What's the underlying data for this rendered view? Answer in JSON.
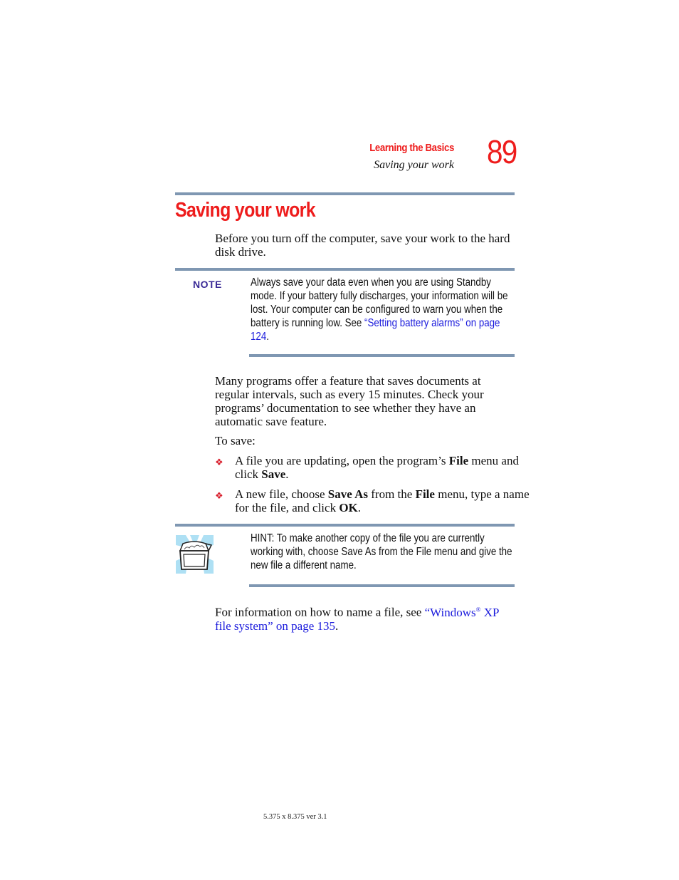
{
  "header": {
    "chapter": "Learning the Basics",
    "section": "Saving your work",
    "page_number": "89"
  },
  "title": "Saving your work",
  "intro": "Before you turn off the computer, save your work to the hard disk drive.",
  "note": {
    "label": "NOTE",
    "text_before_link": "Always save your data even when you are using Standby mode. If your battery fully discharges, your information will be lost. Your computer can be configured to warn you when the battery is running low. See ",
    "link_text": "“Setting battery alarms” on page 124",
    "text_after_link": "."
  },
  "paragraph": "Many programs offer a feature that saves documents at regular intervals, such as every 15 minutes. Check your programs’ documentation to see whether they have an automatic save feature.",
  "to_save": "To save:",
  "bullets": [
    {
      "icon": "diamond-bullet-icon",
      "parts": [
        {
          "text": "A file you are updating, open the program’s ",
          "bold": false
        },
        {
          "text": "File",
          "bold": true
        },
        {
          "text": " menu and click ",
          "bold": false
        },
        {
          "text": "Save",
          "bold": true
        },
        {
          "text": ".",
          "bold": false
        }
      ]
    },
    {
      "icon": "diamond-bullet-icon",
      "parts": [
        {
          "text": "A new file, choose ",
          "bold": false
        },
        {
          "text": "Save As",
          "bold": true
        },
        {
          "text": " from the ",
          "bold": false
        },
        {
          "text": "File",
          "bold": true
        },
        {
          "text": " menu, type a name for the file, and click ",
          "bold": false
        },
        {
          "text": "OK",
          "bold": true
        },
        {
          "text": ".",
          "bold": false
        }
      ]
    }
  ],
  "hint": {
    "icon": "treasure-chest-icon",
    "text": "HINT: To make another copy of the file you are currently working with, choose Save As from the File menu and give the new file a different name."
  },
  "closing": {
    "text_before_link": "For information on how to name a file, see ",
    "link_text_1": "“Windows",
    "link_sup": "®",
    "link_text_2": " XP file system” on page 135",
    "text_after_link": "."
  },
  "footer": "5.375 x 8.375 ver 3.1",
  "colors": {
    "accent_red": "#ee1c1c",
    "link_blue": "#1a1adc",
    "rule_blue_gray": "#7f97b2",
    "note_label_purple": "#3a2a96"
  }
}
